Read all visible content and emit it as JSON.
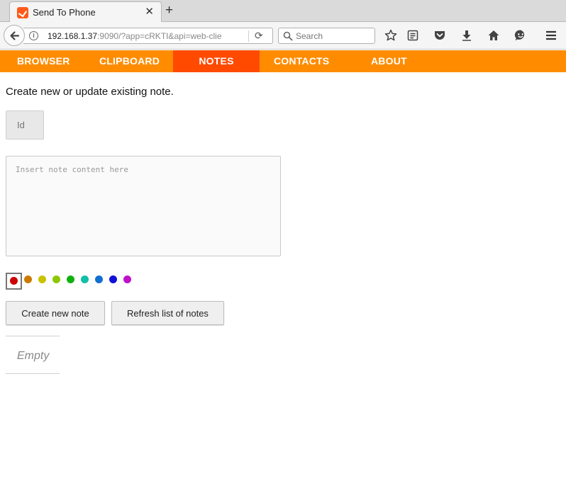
{
  "browser": {
    "tab_title": "Send To Phone",
    "tab_close": "✕",
    "new_tab": "+",
    "url_host": "192.168.1.37",
    "url_rest": ":9090/?app=cRKTI&api=web-clie",
    "search_placeholder": "Search"
  },
  "app_nav": {
    "items": [
      {
        "label": "BROWSER"
      },
      {
        "label": "CLIPBOARD"
      },
      {
        "label": "NOTES"
      },
      {
        "label": "CONTACTS"
      },
      {
        "label": "ABOUT"
      }
    ],
    "active": "NOTES",
    "bar_color": "#ff8c00",
    "active_color": "#ff4a00"
  },
  "notes": {
    "intro": "Create new or update existing note.",
    "id_placeholder": "Id",
    "content_placeholder": "Insert note content here",
    "colors": [
      "#cc0000",
      "#cc7a00",
      "#c8c200",
      "#8cc800",
      "#10b010",
      "#10c0a8",
      "#1070d0",
      "#1010d8",
      "#c010c8"
    ],
    "selected_color": "#cc0000",
    "create_button": "Create new note",
    "refresh_button": "Refresh list of notes",
    "empty_label": "Empty"
  }
}
